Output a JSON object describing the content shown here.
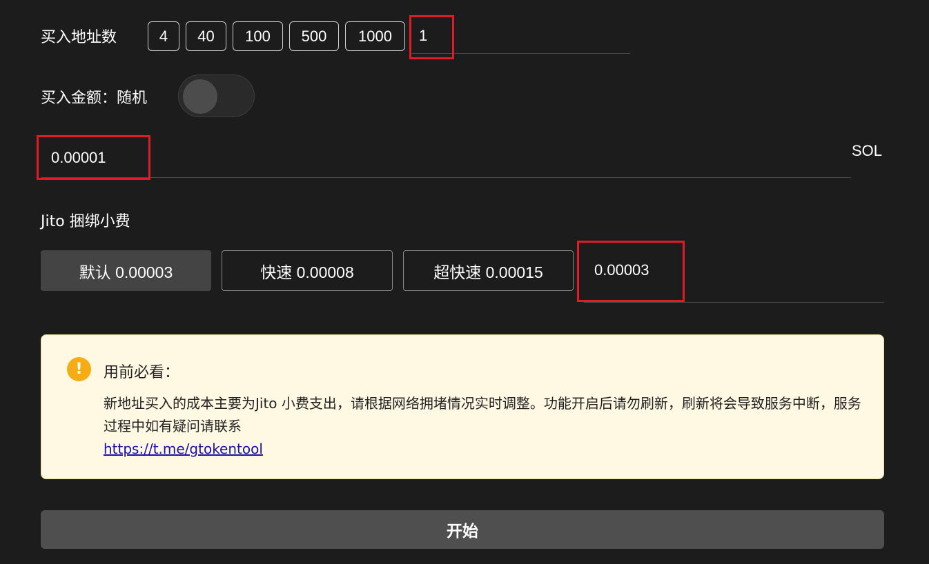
{
  "buy_address": {
    "label": "买入地址数",
    "options": [
      "4",
      "40",
      "100",
      "500",
      "1000"
    ],
    "input_value": "1"
  },
  "buy_amount": {
    "label": "买入金额：随机",
    "random_enabled": false,
    "input_value": "0.00001",
    "unit": "SOL"
  },
  "jito": {
    "label": "Jito 捆绑小费",
    "options": [
      {
        "label": "默认 0.00003",
        "selected": true
      },
      {
        "label": "快速 0.00008",
        "selected": false
      },
      {
        "label": "超快速 0.00015",
        "selected": false
      }
    ],
    "input_value": "0.00003"
  },
  "notice": {
    "icon": "exclamation-icon",
    "title": "用前必看：",
    "body": "新地址买入的成本主要为Jito 小费支出，请根据网络拥堵情况实时调整。功能开启后请勿刷新，刷新将会导致服务中断，服务过程中如有疑问请联系",
    "link": "https://t.me/gtokentool"
  },
  "colors": {
    "background": "#1c1c1c",
    "highlight_box": "#e01b24",
    "notice_bg": "#fff9e4",
    "warning_icon": "#f6ad15"
  },
  "start_button": "开始"
}
